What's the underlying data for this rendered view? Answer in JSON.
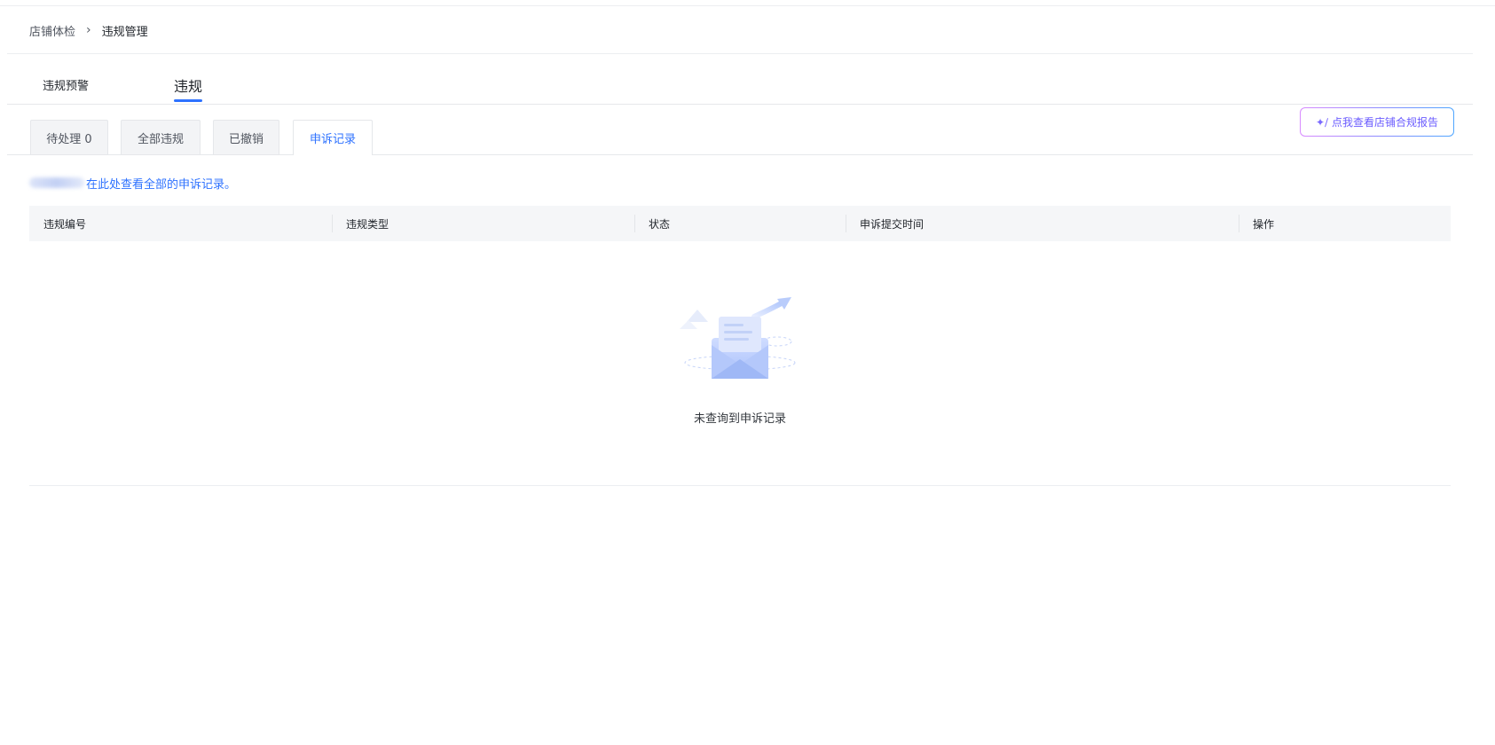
{
  "breadcrumb": {
    "parent": "店铺体检",
    "separator": "›",
    "current": "违规管理"
  },
  "main_tabs": [
    {
      "label": "违规预警",
      "active": false
    },
    {
      "label": "违规",
      "active": true
    }
  ],
  "sub_tabs": [
    {
      "label": "待处理 0",
      "active": false
    },
    {
      "label": "全部违规",
      "active": false
    },
    {
      "label": "已撤销",
      "active": false
    },
    {
      "label": "申诉记录",
      "active": true
    }
  ],
  "report_button": {
    "icon": "sparkle-wand-icon",
    "label": "点我查看店铺合规报告"
  },
  "notice": {
    "text": "在此处查看全部的申诉记录。"
  },
  "table": {
    "columns": [
      "违规编号",
      "违规类型",
      "状态",
      "申诉提交时间",
      "操作"
    ],
    "rows": [],
    "empty_text": "未查询到申诉记录"
  },
  "colors": {
    "accent": "#2e72ff",
    "header_bg": "#f5f6f8",
    "tab_bg": "#f3f4f6",
    "text": "#1f2329"
  }
}
